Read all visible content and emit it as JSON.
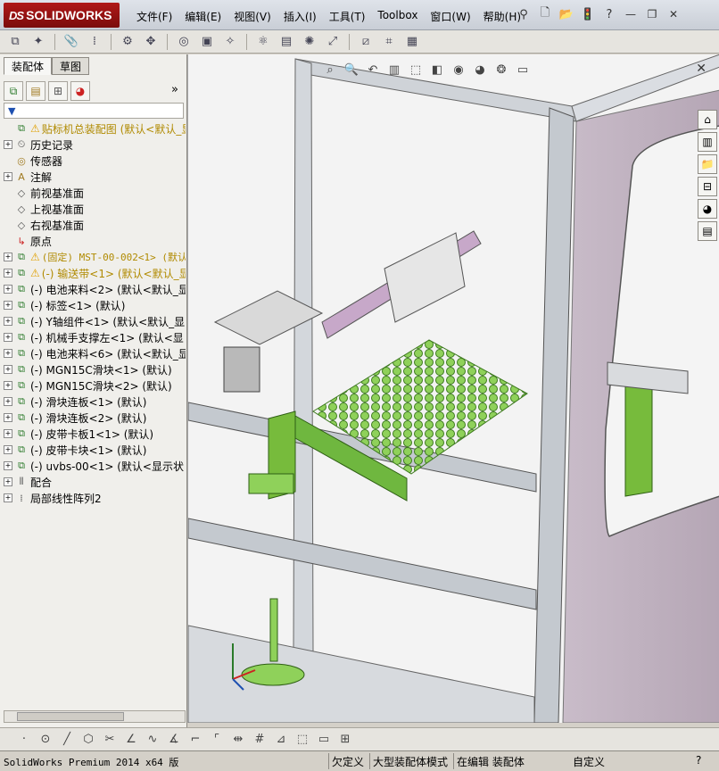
{
  "app": {
    "logo_prefix": "DS",
    "logo_text": "SOLIDWORKS",
    "menus": [
      "文件(F)",
      "编辑(E)",
      "视图(V)",
      "插入(I)",
      "工具(T)",
      "Toolbox",
      "窗口(W)",
      "帮助(H)"
    ],
    "accent": "#a31515"
  },
  "left_panel": {
    "tabs": [
      "装配体",
      "草图"
    ],
    "expand_glyph": "»",
    "filter_glyph": "▼",
    "tree": [
      {
        "label": "贴标机总装配图  (默认<默认_显",
        "icon": "assembly-icon",
        "warn": true,
        "exp": "none",
        "style": "yellow"
      },
      {
        "label": "历史记录",
        "icon": "history-icon",
        "exp": "+"
      },
      {
        "label": "传感器",
        "icon": "sensor-icon",
        "exp": "none"
      },
      {
        "label": "注解",
        "icon": "annotation-icon",
        "exp": "+"
      },
      {
        "label": "前视基准面",
        "icon": "plane-icon",
        "exp": "none"
      },
      {
        "label": "上视基准面",
        "icon": "plane-icon",
        "exp": "none"
      },
      {
        "label": "右视基准面",
        "icon": "plane-icon",
        "exp": "none"
      },
      {
        "label": "原点",
        "icon": "origin-icon",
        "exp": "none"
      },
      {
        "label": "(固定) MST-00-002<1> (默认",
        "icon": "part-icon",
        "warn": true,
        "exp": "+",
        "style": "yellow",
        "mono": true
      },
      {
        "label": "(-) 输送带<1> (默认<默认_显",
        "icon": "part-icon",
        "warn": true,
        "exp": "+",
        "style": "yellow"
      },
      {
        "label": "(-) 电池来料<2> (默认<默认_显",
        "icon": "part-icon",
        "exp": "+"
      },
      {
        "label": "(-) 标签<1> (默认)",
        "icon": "part-icon",
        "exp": "+"
      },
      {
        "label": "(-) Y轴组件<1> (默认<默认_显",
        "icon": "part-icon",
        "exp": "+"
      },
      {
        "label": "(-) 机械手支撑左<1> (默认<显",
        "icon": "part-icon",
        "exp": "+"
      },
      {
        "label": "(-) 电池来料<6> (默认<默认_显",
        "icon": "part-icon",
        "exp": "+"
      },
      {
        "label": "(-) MGN15C滑块<1> (默认)",
        "icon": "part-icon",
        "exp": "+"
      },
      {
        "label": "(-) MGN15C滑块<2> (默认)",
        "icon": "part-icon",
        "exp": "+"
      },
      {
        "label": "(-) 滑块连板<1> (默认)",
        "icon": "part-icon",
        "exp": "+"
      },
      {
        "label": "(-) 滑块连板<2> (默认)",
        "icon": "part-icon",
        "exp": "+"
      },
      {
        "label": "(-) 皮带卡板1<1> (默认)",
        "icon": "part-icon",
        "exp": "+"
      },
      {
        "label": "(-) 皮带卡块<1> (默认)",
        "icon": "part-icon",
        "exp": "+"
      },
      {
        "label": "(-) uvbs-00<1> (默认<显示状",
        "icon": "part-icon",
        "exp": "+"
      },
      {
        "label": "配合",
        "icon": "mate-icon",
        "exp": "+"
      },
      {
        "label": "局部线性阵列2",
        "icon": "pattern-icon",
        "exp": "+"
      }
    ]
  },
  "status": {
    "product": "SolidWorks Premium 2014 x64 版",
    "definition": "欠定义",
    "mode": "大型装配体模式",
    "editing": "在编辑 装配体",
    "units": "自定义",
    "help_glyph": "?"
  }
}
